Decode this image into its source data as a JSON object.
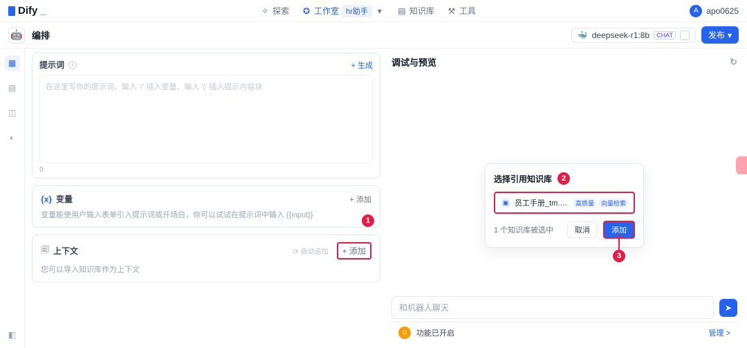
{
  "brand": {
    "name": "Dify",
    "underscore": "_"
  },
  "topnav": {
    "explore": "探索",
    "workspace": "工作室",
    "app_name": "hr助手",
    "knowledge": "知识库",
    "tools": "工具"
  },
  "user": {
    "initial": "A",
    "name": "apo0625"
  },
  "subheader": {
    "title": "编排",
    "model": "deepseek-r1:8b",
    "chat_tag": "CHAT",
    "publish": "发布"
  },
  "prompt": {
    "title": "提示词",
    "generate": "+ 生成",
    "placeholder": "在这里写你的提示词，输入 '/' 插入变量、输入 '{' 插入提示内容块",
    "count": "0"
  },
  "variables": {
    "icon": "{x}",
    "title": "变量",
    "add": "+ 添加",
    "desc": "变量能使用户输入表单引入提示词或开场白，你可以试试在提示词中输入 {{input}}"
  },
  "context": {
    "title": "上下文",
    "auto": "⟳ 自动追加",
    "add": "+ 添加",
    "desc": "您可以导入知识库作为上下文"
  },
  "debug": {
    "title": "调试与预览",
    "chat_placeholder": "和机器人聊天"
  },
  "dialog": {
    "title": "选择引用知识库",
    "kb_name": "员工手册_tm.pdf...",
    "tag1": "高质量",
    "tag2": "向量检索",
    "selected": "1 个知识库被选中",
    "cancel": "取消",
    "confirm": "添加"
  },
  "annotations": {
    "n1": "1",
    "n2": "2",
    "n3": "3"
  },
  "footer": {
    "status": "功能已开启",
    "manage": "管理 >"
  }
}
